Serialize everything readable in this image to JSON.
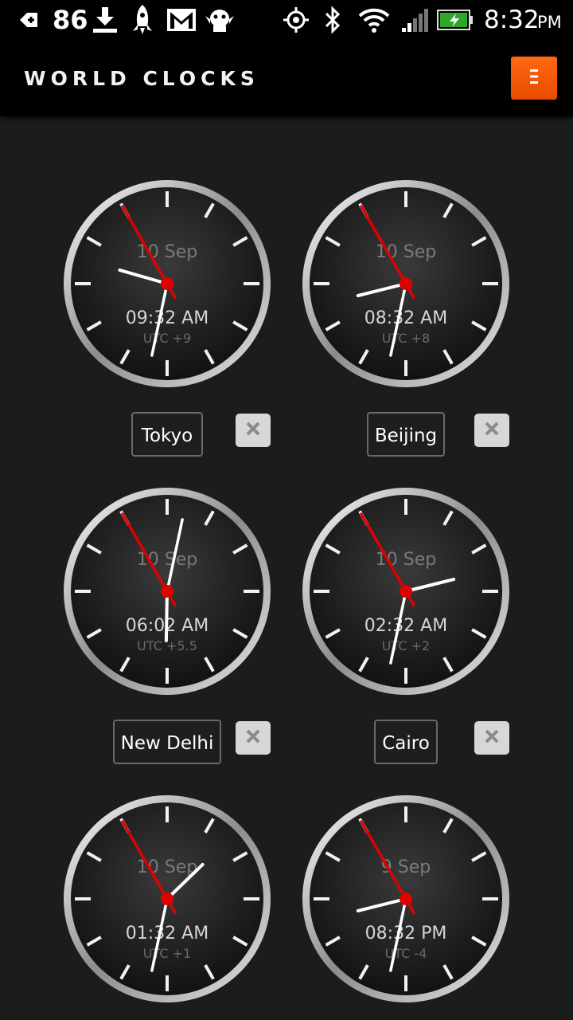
{
  "status_bar": {
    "notification_count": "86",
    "time": "8:32",
    "ampm": "PM",
    "icons": [
      "back-arrow-icon",
      "download-icon",
      "rocket-icon",
      "gmail-icon",
      "robot-icon",
      "gps-icon",
      "bluetooth-icon",
      "wifi-icon",
      "signal-icon",
      "battery-icon"
    ]
  },
  "app": {
    "title": "WORLD CLOCKS",
    "menu_icon": "menu-icon",
    "accent_color": "#f25a06"
  },
  "clocks": [
    {
      "city": "Tokyo",
      "date": "10 Sep",
      "time": "09:32 AM",
      "utc": "UTC +9",
      "hour": 9,
      "minute": 32,
      "second": 55
    },
    {
      "city": "Beijing",
      "date": "10 Sep",
      "time": "08:32 AM",
      "utc": "UTC +8",
      "hour": 8,
      "minute": 32,
      "second": 55
    },
    {
      "city": "New Delhi",
      "date": "10 Sep",
      "time": "06:02 AM",
      "utc": "UTC +5.5",
      "hour": 6,
      "minute": 2,
      "second": 55
    },
    {
      "city": "Cairo",
      "date": "10 Sep",
      "time": "02:32 AM",
      "utc": "UTC +2",
      "hour": 2,
      "minute": 32,
      "second": 55
    },
    {
      "city": "",
      "date": "10 Sep",
      "time": "01:32 AM",
      "utc": "UTC +1",
      "hour": 1,
      "minute": 32,
      "second": 55
    },
    {
      "city": "",
      "date": "9 Sep",
      "time": "08:32 PM",
      "utc": "UTC -4",
      "hour": 8,
      "minute": 32,
      "second": 55
    }
  ],
  "colors": {
    "second_hand": "#e00000",
    "background": "#1b1d1c"
  }
}
